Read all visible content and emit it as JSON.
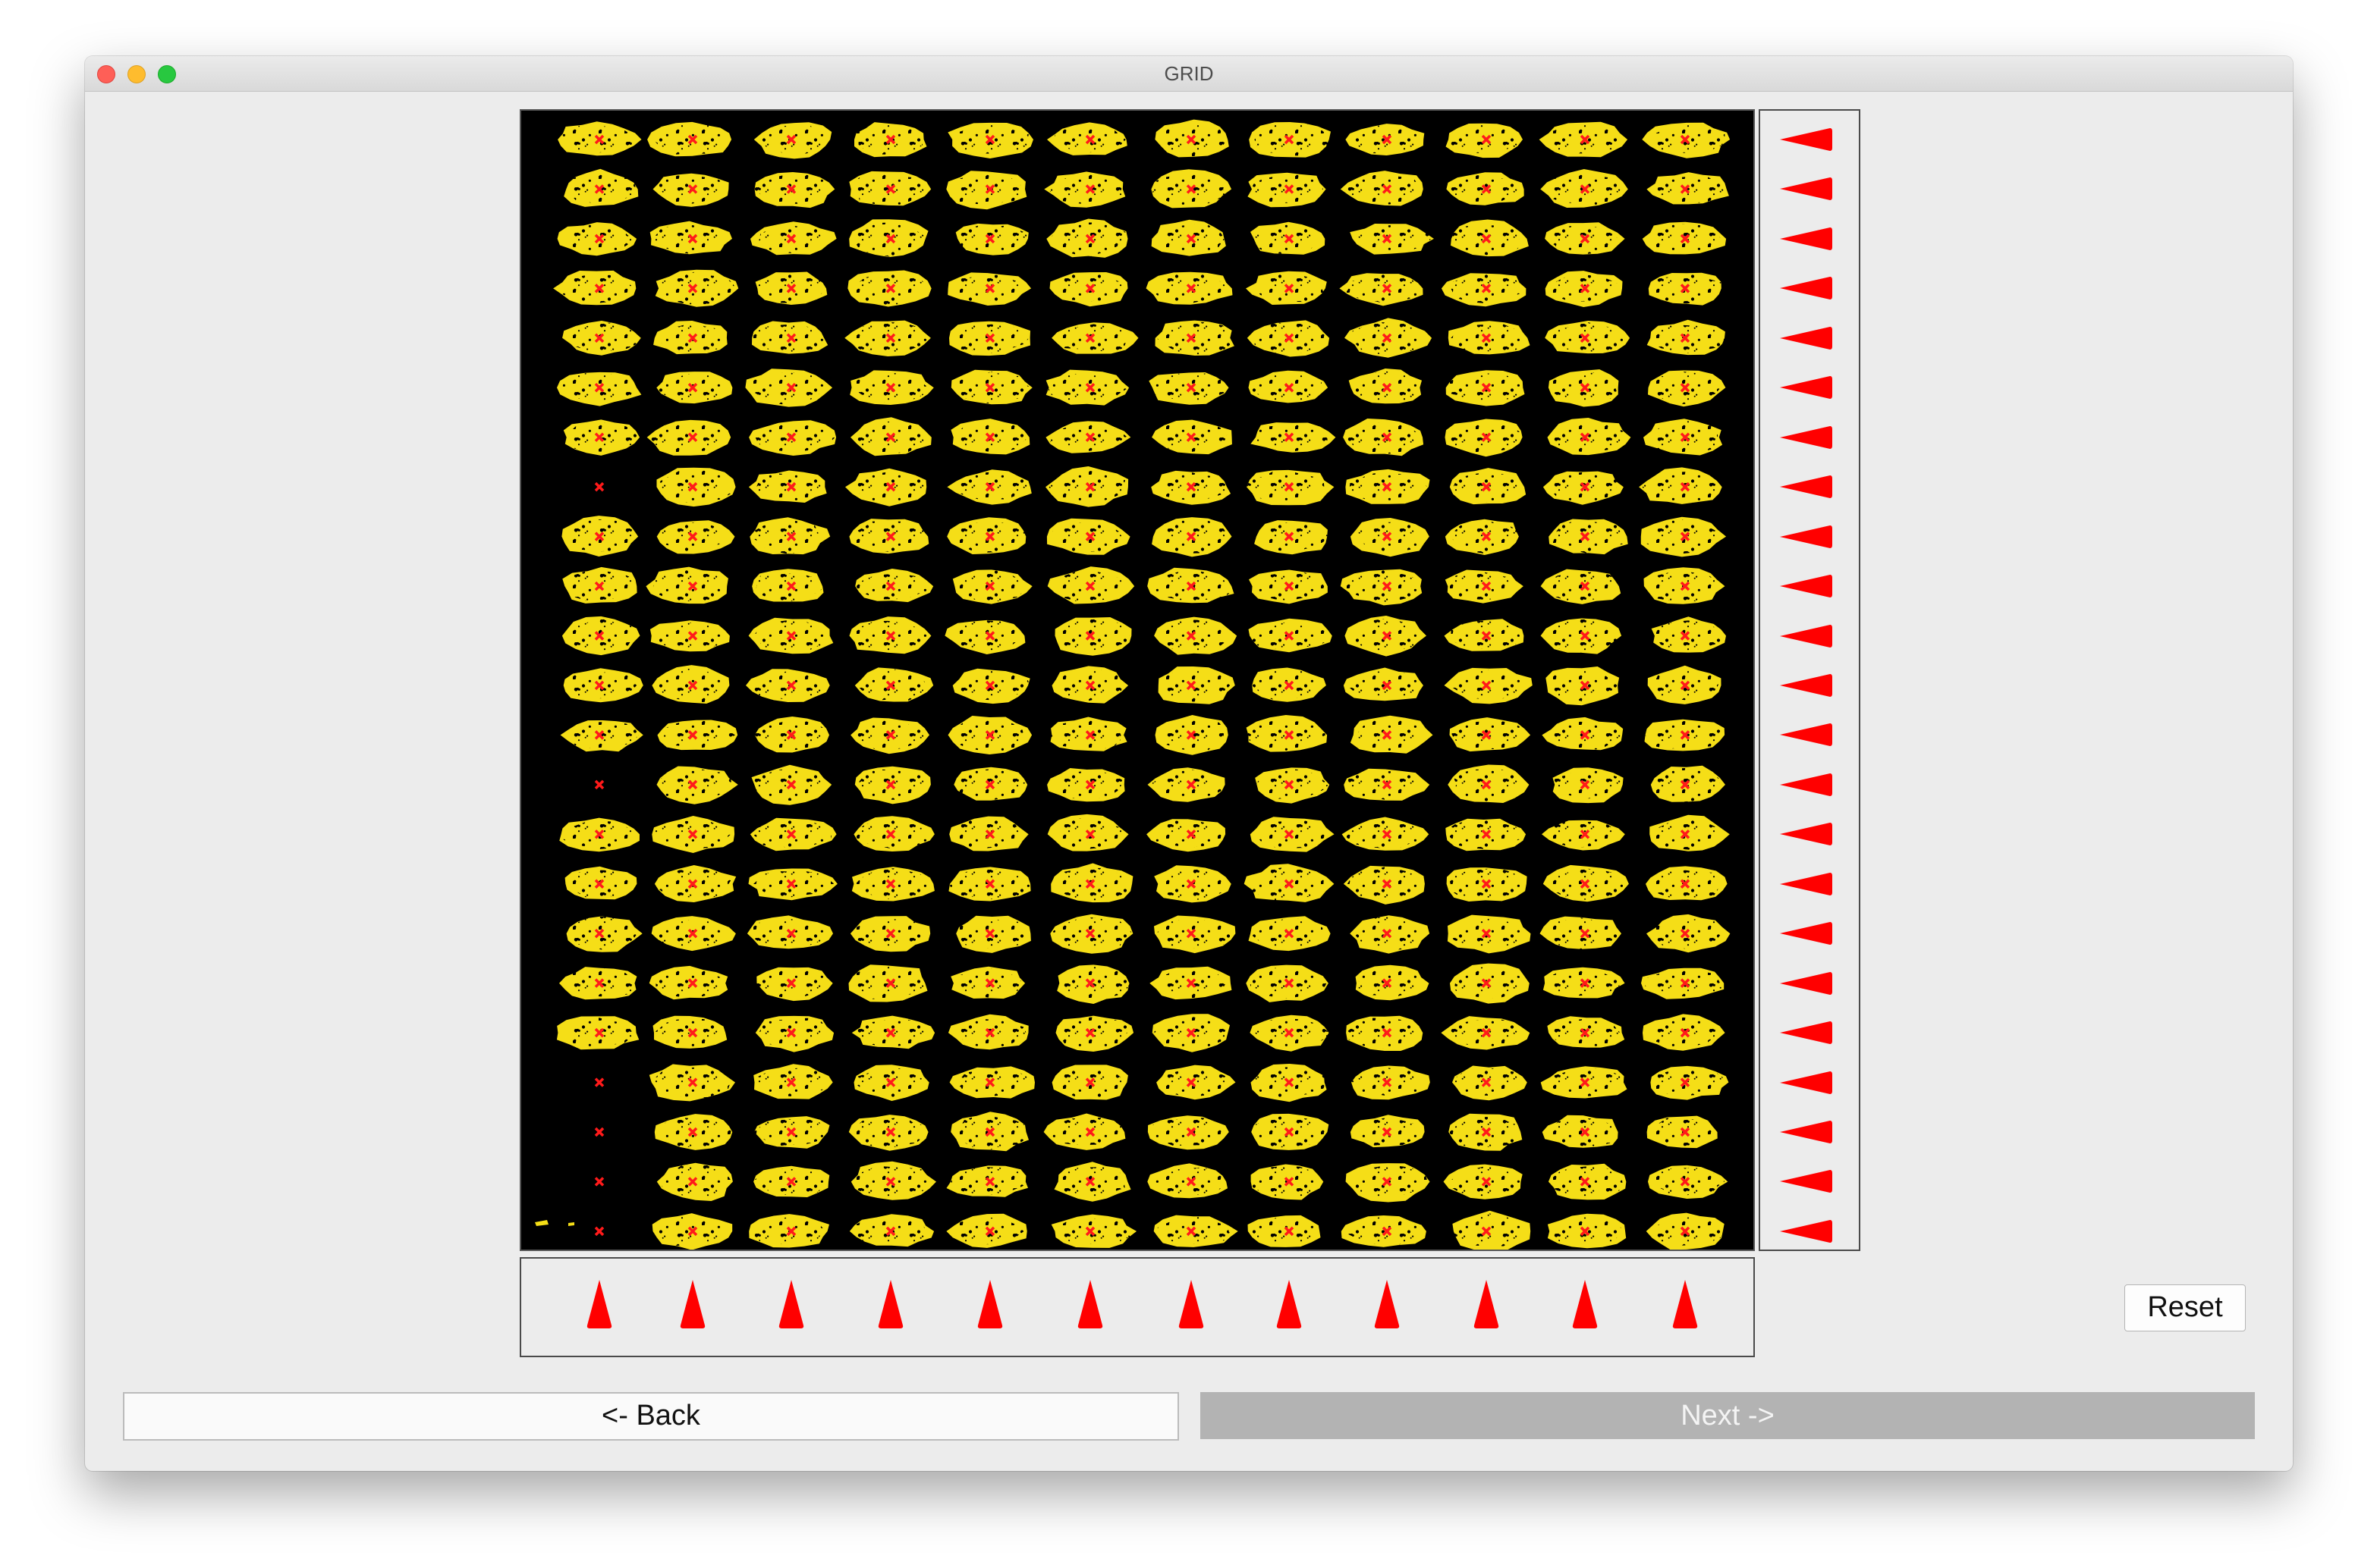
{
  "window": {
    "title": "GRID"
  },
  "grid": {
    "columns": 12,
    "rows": 23,
    "cell_color": "#f5de17",
    "center_marker_color": "#ff1a1a",
    "empty_cells": [
      [
        7,
        0
      ],
      [
        13,
        0
      ],
      [
        19,
        0
      ],
      [
        20,
        0
      ],
      [
        21,
        0
      ],
      [
        22,
        0
      ]
    ]
  },
  "markers": {
    "color": "#ff0000",
    "row_count": 23,
    "column_count": 12
  },
  "buttons": {
    "reset": "Reset",
    "back": "<- Back",
    "next": "Next ->"
  }
}
